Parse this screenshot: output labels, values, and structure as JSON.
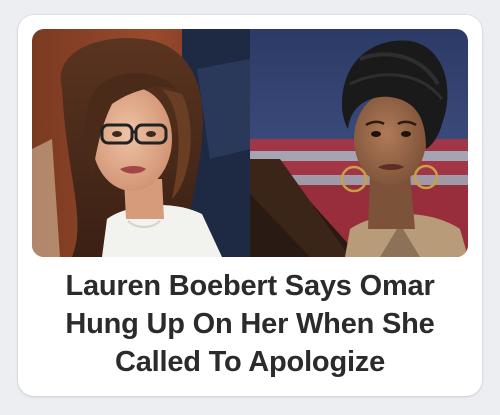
{
  "card": {
    "headline": "Lauren Boebert Says Omar Hung Up On Her When She Called To Apologize"
  },
  "images": {
    "left": {
      "icon": "photo-lauren-boebert"
    },
    "right": {
      "icon": "photo-ilhan-omar"
    }
  },
  "colors": {
    "page_background": "#eceef1",
    "card_background": "#ffffff",
    "headline_text": "#2b2b2b"
  }
}
